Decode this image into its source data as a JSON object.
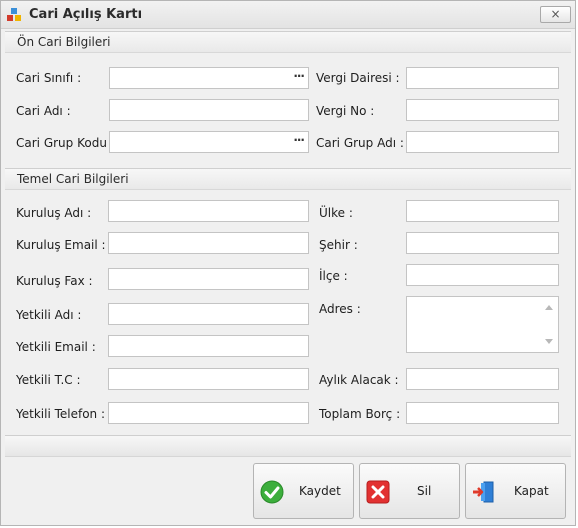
{
  "window": {
    "title": "Cari Açılış Kartı",
    "close_glyph": "×"
  },
  "on_cari": {
    "header": "Ön Cari Bilgileri",
    "cari_sinifi_label": "Cari Sınıfı :",
    "cari_adi_label": "Cari Adı :",
    "cari_grup_kodu_label": "Cari Grup Kodu :",
    "vergi_dairesi_label": "Vergi Dairesi :",
    "vergi_no_label": "Vergi No :",
    "cari_grup_adi_label": "Cari Grup Adı :",
    "ellipsis": "···"
  },
  "temel_cari": {
    "header": "Temel Cari Bilgileri",
    "kurulus_adi_label": "Kuruluş Adı :",
    "kurulus_email_label": "Kuruluş Email :",
    "kurulus_fax_label": "Kuruluş Fax :",
    "yetkili_adi_label": "Yetkili Adı :",
    "yetkili_email_label": "Yetkili Email :",
    "yetkili_tc_label": "Yetkili T.C :",
    "yetkili_telefon_label": "Yetkili Telefon :",
    "ulke_label": "Ülke :",
    "sehir_label": "Şehir :",
    "ilce_label": "İlçe :",
    "adres_label": "Adres :",
    "aylik_alacak_label": "Aylık Alacak :",
    "toplam_borc_label": "Toplam Borç :"
  },
  "buttons": {
    "kaydet": "Kaydet",
    "sil": "Sil",
    "kapat": "Kapat"
  }
}
